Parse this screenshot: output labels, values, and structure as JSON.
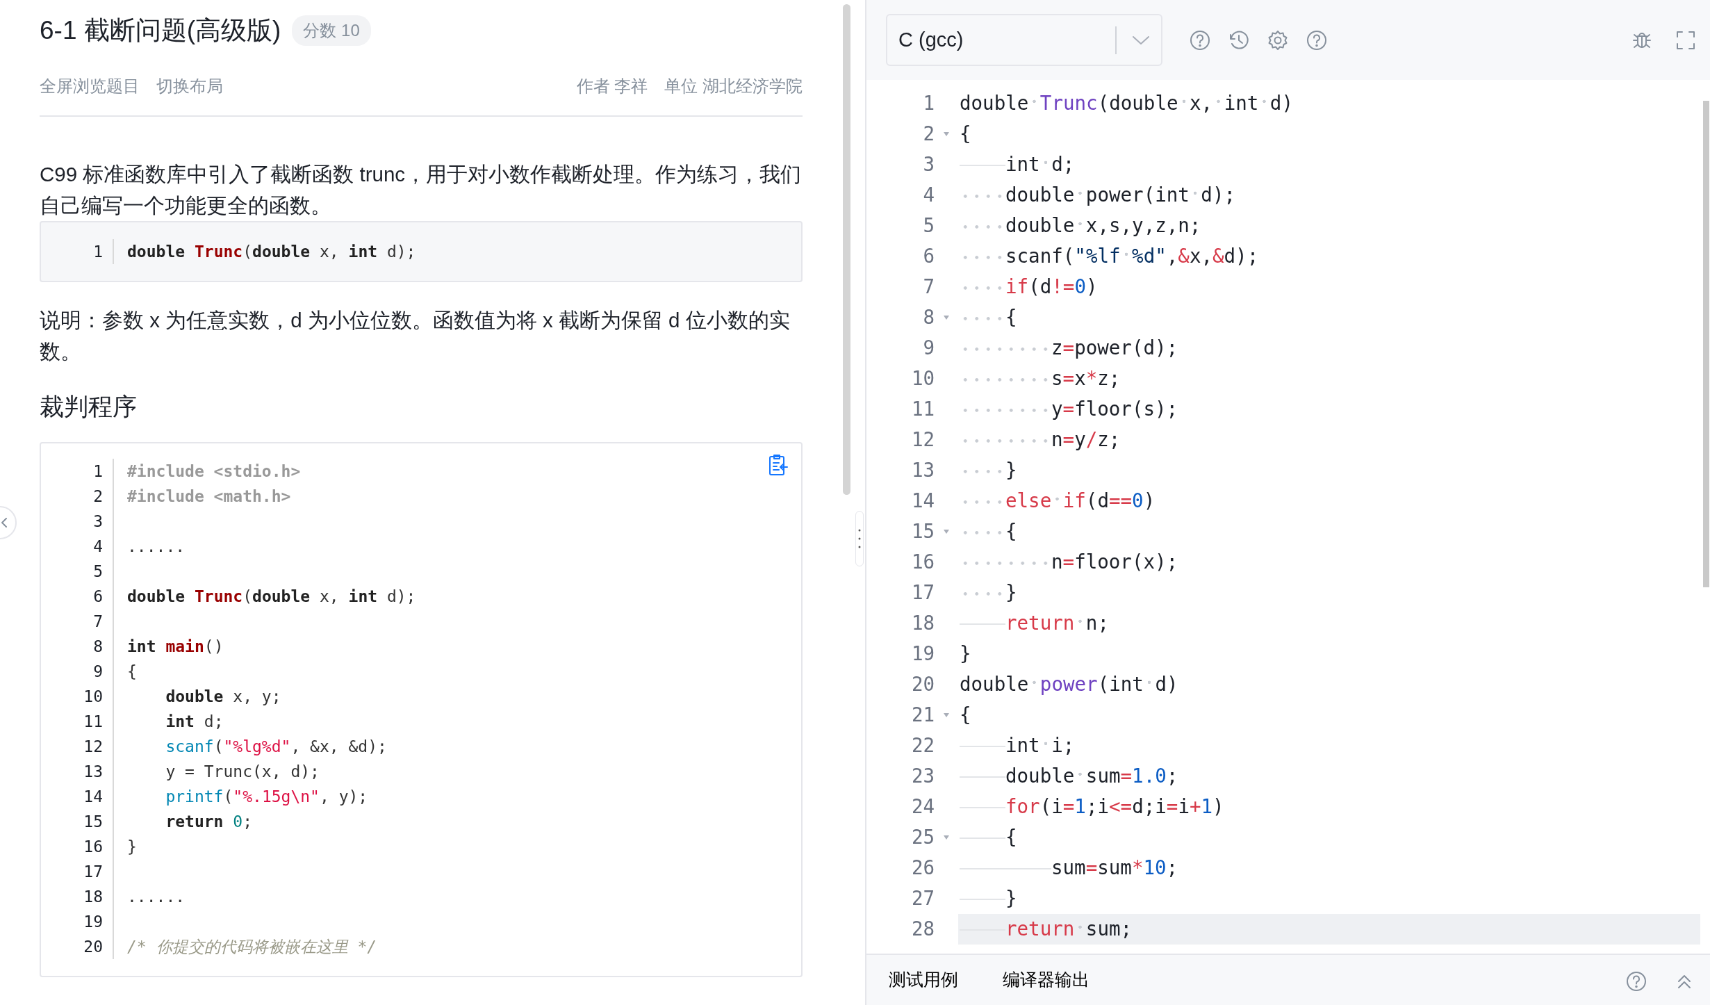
{
  "problem": {
    "title": "6-1 截断问题(高级版)",
    "score_badge": "分数 10",
    "actions": [
      "全屏浏览题目",
      "切换布局"
    ],
    "author": "作者 李祥",
    "unit": "单位 湖北经济学院",
    "intro": "C99 标准函数库中引入了截断函数 trunc，用于对小数作截断处理。作为练习，我们自己编写一个功能更全的函数。",
    "signature": [
      {
        "number": "1",
        "tokens": [
          {
            "text": "double ",
            "kind": "kw"
          },
          {
            "text": "Trunc",
            "kind": "fn"
          },
          {
            "text": "(",
            "kind": "plain"
          },
          {
            "text": "double",
            "kind": "kw"
          },
          {
            "text": " x, ",
            "kind": "plain"
          },
          {
            "text": "int",
            "kind": "kw"
          },
          {
            "text": " d);",
            "kind": "plain"
          }
        ]
      }
    ],
    "note": "说明：参数 x 为任意实数，d 为小位位数。函数值为将 x 截断为保留 d 位小数的实数。",
    "judge_heading": "裁判程序",
    "judge_code": [
      {
        "number": "1",
        "tokens": [
          {
            "text": "#include <stdio.h>",
            "kind": "pre"
          }
        ]
      },
      {
        "number": "2",
        "tokens": [
          {
            "text": "#include <math.h>",
            "kind": "pre"
          }
        ]
      },
      {
        "number": "3"
      },
      {
        "number": "4",
        "tokens": [
          {
            "text": "......",
            "kind": "plain"
          }
        ]
      },
      {
        "number": "5"
      },
      {
        "number": "6",
        "tokens": [
          {
            "text": "double ",
            "kind": "kw"
          },
          {
            "text": "Trunc",
            "kind": "fn"
          },
          {
            "text": "(",
            "kind": "plain"
          },
          {
            "text": "double",
            "kind": "kw"
          },
          {
            "text": " x, ",
            "kind": "plain"
          },
          {
            "text": "int",
            "kind": "kw"
          },
          {
            "text": " d);",
            "kind": "plain"
          }
        ]
      },
      {
        "number": "7"
      },
      {
        "number": "8",
        "tokens": [
          {
            "text": "int ",
            "kind": "kw"
          },
          {
            "text": "main",
            "kind": "fn"
          },
          {
            "text": "()",
            "kind": "plain"
          }
        ]
      },
      {
        "number": "9",
        "tokens": [
          {
            "text": "{",
            "kind": "plain"
          }
        ]
      },
      {
        "number": "10",
        "tokens": [
          {
            "text": "    double",
            "kind": "kw"
          },
          {
            "text": " x, y;",
            "kind": "plain"
          }
        ]
      },
      {
        "number": "11",
        "tokens": [
          {
            "text": "    int",
            "kind": "kw"
          },
          {
            "text": " d;",
            "kind": "plain"
          }
        ]
      },
      {
        "number": "12",
        "tokens": [
          {
            "text": "    scanf",
            "kind": "call"
          },
          {
            "text": "(",
            "kind": "plain"
          },
          {
            "text": "\"%lg%d\"",
            "kind": "str"
          },
          {
            "text": ", &x, &d);",
            "kind": "plain"
          }
        ]
      },
      {
        "number": "13",
        "tokens": [
          {
            "text": "    y = Trunc(x, d);",
            "kind": "plain"
          }
        ]
      },
      {
        "number": "14",
        "tokens": [
          {
            "text": "    printf",
            "kind": "call"
          },
          {
            "text": "(",
            "kind": "plain"
          },
          {
            "text": "\"%.15g\\n\"",
            "kind": "str"
          },
          {
            "text": ", y);",
            "kind": "plain"
          }
        ]
      },
      {
        "number": "15",
        "tokens": [
          {
            "text": "    return ",
            "kind": "kw"
          },
          {
            "text": "0",
            "kind": "num"
          },
          {
            "text": ";",
            "kind": "plain"
          }
        ]
      },
      {
        "number": "16",
        "tokens": [
          {
            "text": "}",
            "kind": "plain"
          }
        ]
      },
      {
        "number": "17"
      },
      {
        "number": "18",
        "tokens": [
          {
            "text": "......",
            "kind": "plain"
          }
        ]
      },
      {
        "number": "19"
      },
      {
        "number": "20",
        "tokens": [
          {
            "text": "/* 你提交的代码将被嵌在这里 */",
            "kind": "comment"
          }
        ]
      }
    ]
  },
  "editor": {
    "language": "C (gcc)",
    "lines": [
      {
        "number": "1",
        "fold": false,
        "current": false,
        "tokens": [
          {
            "text": "double ",
            "kind": "plain"
          },
          {
            "text": "Trunc",
            "kind": "def"
          },
          {
            "text": "(double x, int d)",
            "kind": "plain"
          }
        ]
      },
      {
        "number": "2",
        "fold": true,
        "current": false,
        "tokens": [
          {
            "text": "{",
            "kind": "plain"
          }
        ]
      },
      {
        "number": "3",
        "fold": false,
        "current": false,
        "indent": [
          {
            "kind": "tab"
          }
        ],
        "tokens": [
          {
            "text": "int d;",
            "kind": "plain"
          }
        ]
      },
      {
        "number": "4",
        "fold": false,
        "current": false,
        "indent": [
          {
            "kind": "spaces"
          }
        ],
        "tokens": [
          {
            "text": "double power(int d);",
            "kind": "plain"
          }
        ]
      },
      {
        "number": "5",
        "fold": false,
        "current": false,
        "indent": [
          {
            "kind": "spaces"
          }
        ],
        "tokens": [
          {
            "text": "double x,s,y,z,n;",
            "kind": "plain"
          }
        ]
      },
      {
        "number": "6",
        "fold": false,
        "current": false,
        "indent": [
          {
            "kind": "spaces"
          }
        ],
        "tokens": [
          {
            "text": "scanf(",
            "kind": "plain"
          },
          {
            "text": "\"%lf %d\"",
            "kind": "str"
          },
          {
            "text": ",",
            "kind": "plain"
          },
          {
            "text": "&",
            "kind": "op"
          },
          {
            "text": "x,",
            "kind": "plain"
          },
          {
            "text": "&",
            "kind": "op"
          },
          {
            "text": "d);",
            "kind": "plain"
          }
        ]
      },
      {
        "number": "7",
        "fold": false,
        "current": false,
        "indent": [
          {
            "kind": "spaces"
          }
        ],
        "tokens": [
          {
            "text": "if",
            "kind": "kw"
          },
          {
            "text": "(d",
            "kind": "plain"
          },
          {
            "text": "!=",
            "kind": "op"
          },
          {
            "text": "0",
            "kind": "num"
          },
          {
            "text": ")",
            "kind": "plain"
          }
        ]
      },
      {
        "number": "8",
        "fold": true,
        "current": false,
        "indent": [
          {
            "kind": "spaces"
          }
        ],
        "tokens": [
          {
            "text": "{",
            "kind": "plain"
          }
        ]
      },
      {
        "number": "9",
        "fold": false,
        "current": false,
        "indent": [
          {
            "kind": "spaces"
          },
          {
            "kind": "spaces"
          }
        ],
        "tokens": [
          {
            "text": "z",
            "kind": "plain"
          },
          {
            "text": "=",
            "kind": "op"
          },
          {
            "text": "power(d);",
            "kind": "plain"
          }
        ]
      },
      {
        "number": "10",
        "fold": false,
        "current": false,
        "indent": [
          {
            "kind": "spaces"
          },
          {
            "kind": "spaces"
          }
        ],
        "tokens": [
          {
            "text": "s",
            "kind": "plain"
          },
          {
            "text": "=",
            "kind": "op"
          },
          {
            "text": "x",
            "kind": "plain"
          },
          {
            "text": "*",
            "kind": "op"
          },
          {
            "text": "z;",
            "kind": "plain"
          }
        ]
      },
      {
        "number": "11",
        "fold": false,
        "current": false,
        "indent": [
          {
            "kind": "spaces"
          },
          {
            "kind": "spaces"
          }
        ],
        "tokens": [
          {
            "text": "y",
            "kind": "plain"
          },
          {
            "text": "=",
            "kind": "op"
          },
          {
            "text": "floor(s);",
            "kind": "plain"
          }
        ]
      },
      {
        "number": "12",
        "fold": false,
        "current": false,
        "indent": [
          {
            "kind": "spaces"
          },
          {
            "kind": "spaces"
          }
        ],
        "tokens": [
          {
            "text": "n",
            "kind": "plain"
          },
          {
            "text": "=",
            "kind": "op"
          },
          {
            "text": "y",
            "kind": "plain"
          },
          {
            "text": "/",
            "kind": "op"
          },
          {
            "text": "z;",
            "kind": "plain"
          }
        ]
      },
      {
        "number": "13",
        "fold": false,
        "current": false,
        "indent": [
          {
            "kind": "spaces"
          }
        ],
        "tokens": [
          {
            "text": "}",
            "kind": "plain"
          }
        ]
      },
      {
        "number": "14",
        "fold": false,
        "current": false,
        "indent": [
          {
            "kind": "spaces"
          }
        ],
        "tokens": [
          {
            "text": "else if",
            "kind": "kw"
          },
          {
            "text": "(d",
            "kind": "plain"
          },
          {
            "text": "==",
            "kind": "op"
          },
          {
            "text": "0",
            "kind": "num"
          },
          {
            "text": ")",
            "kind": "plain"
          }
        ]
      },
      {
        "number": "15",
        "fold": true,
        "current": false,
        "indent": [
          {
            "kind": "spaces"
          }
        ],
        "tokens": [
          {
            "text": "{",
            "kind": "plain"
          }
        ]
      },
      {
        "number": "16",
        "fold": false,
        "current": false,
        "indent": [
          {
            "kind": "spaces"
          },
          {
            "kind": "spaces"
          }
        ],
        "tokens": [
          {
            "text": "n",
            "kind": "plain"
          },
          {
            "text": "=",
            "kind": "op"
          },
          {
            "text": "floor(x);",
            "kind": "plain"
          }
        ]
      },
      {
        "number": "17",
        "fold": false,
        "current": false,
        "indent": [
          {
            "kind": "spaces"
          }
        ],
        "tokens": [
          {
            "text": "}",
            "kind": "plain"
          }
        ]
      },
      {
        "number": "18",
        "fold": false,
        "current": false,
        "indent": [
          {
            "kind": "tab"
          }
        ],
        "tokens": [
          {
            "text": "return",
            "kind": "kw"
          },
          {
            "text": " n;",
            "kind": "plain"
          }
        ]
      },
      {
        "number": "19",
        "fold": false,
        "current": false,
        "tokens": [
          {
            "text": "}",
            "kind": "plain"
          }
        ]
      },
      {
        "number": "20",
        "fold": false,
        "current": false,
        "tokens": [
          {
            "text": "double ",
            "kind": "plain"
          },
          {
            "text": "power",
            "kind": "def"
          },
          {
            "text": "(int d)",
            "kind": "plain"
          }
        ]
      },
      {
        "number": "21",
        "fold": true,
        "current": false,
        "tokens": [
          {
            "text": "{",
            "kind": "plain"
          }
        ]
      },
      {
        "number": "22",
        "fold": false,
        "current": false,
        "indent": [
          {
            "kind": "tab"
          }
        ],
        "tokens": [
          {
            "text": "int i;",
            "kind": "plain"
          }
        ]
      },
      {
        "number": "23",
        "fold": false,
        "current": false,
        "indent": [
          {
            "kind": "tab"
          }
        ],
        "tokens": [
          {
            "text": "double sum",
            "kind": "plain"
          },
          {
            "text": "=",
            "kind": "op"
          },
          {
            "text": "1.0",
            "kind": "num"
          },
          {
            "text": ";",
            "kind": "plain"
          }
        ]
      },
      {
        "number": "24",
        "fold": false,
        "current": false,
        "indent": [
          {
            "kind": "tab"
          }
        ],
        "tokens": [
          {
            "text": "for",
            "kind": "kw"
          },
          {
            "text": "(i",
            "kind": "plain"
          },
          {
            "text": "=",
            "kind": "op"
          },
          {
            "text": "1",
            "kind": "num"
          },
          {
            "text": ";i",
            "kind": "plain"
          },
          {
            "text": "<=",
            "kind": "op"
          },
          {
            "text": "d;i",
            "kind": "plain"
          },
          {
            "text": "=",
            "kind": "op"
          },
          {
            "text": "i",
            "kind": "plain"
          },
          {
            "text": "+",
            "kind": "op"
          },
          {
            "text": "1",
            "kind": "num"
          },
          {
            "text": ")",
            "kind": "plain"
          }
        ]
      },
      {
        "number": "25",
        "fold": true,
        "current": false,
        "indent": [
          {
            "kind": "tab"
          }
        ],
        "tokens": [
          {
            "text": "{",
            "kind": "plain"
          }
        ]
      },
      {
        "number": "26",
        "fold": false,
        "current": false,
        "indent": [
          {
            "kind": "tab"
          },
          {
            "kind": "tab"
          }
        ],
        "tokens": [
          {
            "text": "sum",
            "kind": "plain"
          },
          {
            "text": "=",
            "kind": "op"
          },
          {
            "text": "sum",
            "kind": "plain"
          },
          {
            "text": "*",
            "kind": "op"
          },
          {
            "text": "10",
            "kind": "num"
          },
          {
            "text": ";",
            "kind": "plain"
          }
        ]
      },
      {
        "number": "27",
        "fold": false,
        "current": false,
        "indent": [
          {
            "kind": "tab"
          }
        ],
        "tokens": [
          {
            "text": "}",
            "kind": "plain"
          }
        ]
      },
      {
        "number": "28",
        "fold": false,
        "current": true,
        "indent": [
          {
            "kind": "tab"
          }
        ],
        "tokens": [
          {
            "text": "return",
            "kind": "kw"
          },
          {
            "text": " sum;",
            "kind": "plain"
          }
        ]
      }
    ]
  },
  "bottom_tabs": [
    "测试用例",
    "编译器输出"
  ]
}
